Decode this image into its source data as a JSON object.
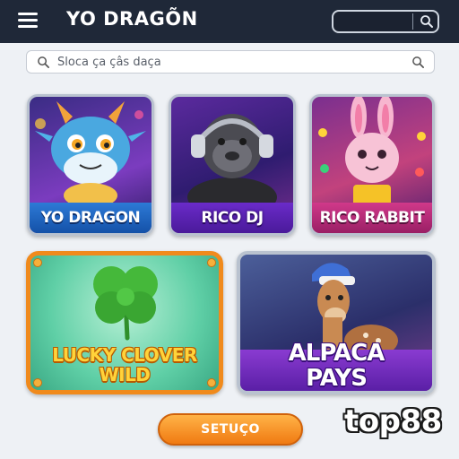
{
  "header": {
    "title": "YO DRAGÕN",
    "menu_icon": "hamburger-menu-icon",
    "search_icon": "search-icon"
  },
  "search": {
    "placeholder": "Sloca ça çâs daça",
    "value": ""
  },
  "games": {
    "yo_dragon": {
      "label": "YO DRAGON",
      "icon": "dragon-mascot"
    },
    "rico_dj": {
      "label": "RICO DJ",
      "icon": "gorilla-headphones-mascot"
    },
    "rico_rabbit": {
      "label": "RICO RABBIT",
      "icon": "rabbit-mascot"
    },
    "lucky_clover": {
      "label_line1": "LUCKY CLOVER",
      "label_line2": "WILD",
      "icon": "four-leaf-clover"
    },
    "alpaca_pays": {
      "label_line1": "ALPACA",
      "label_line2": "PAYS",
      "icon": "alpaca-mascot"
    }
  },
  "cta": {
    "label": "SETUÇO"
  },
  "watermark": {
    "text": "top88"
  },
  "colors": {
    "topbar": "#1f2838",
    "accent_orange": "#f07a12",
    "clover_border": "#f08a1c",
    "label_purple": "#6a2bc9",
    "label_blue": "#1451a8",
    "label_pink": "#d0398a"
  }
}
